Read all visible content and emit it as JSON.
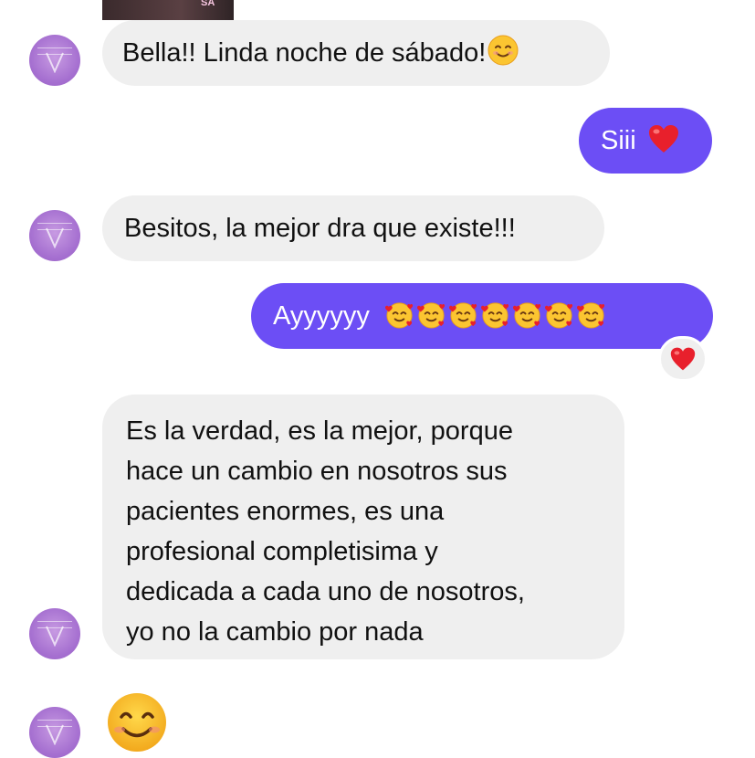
{
  "conversation": {
    "story_thumb_text": "SA",
    "messages": [
      {
        "direction": "incoming",
        "text": "Bella!! Linda noche de sábado!",
        "emoji": "smiling-face-with-smiling-eyes"
      },
      {
        "direction": "outgoing",
        "text": "Siii",
        "emoji": "red-heart"
      },
      {
        "direction": "incoming",
        "text": "Besitos, la mejor dra que existe!!!"
      },
      {
        "direction": "outgoing",
        "text": "Ayyyyyy",
        "emoji": "smiling-face-with-hearts",
        "emoji_count": 7,
        "reaction": "red-heart"
      },
      {
        "direction": "incoming",
        "lines": [
          "Es la verdad, es la mejor, porque",
          "hace un cambio en nosotros sus",
          "pacientes enormes, es una",
          "profesional completisima y",
          "dedicada a cada uno de nosotros,",
          "yo no la cambio por nada"
        ]
      },
      {
        "direction": "incoming",
        "emoji_only": "smiling-face-with-smiling-eyes"
      }
    ]
  },
  "colors": {
    "outgoing_bubble": "#6c4ef5",
    "incoming_bubble": "#efefef",
    "avatar": "#a56fd0",
    "heart": "#e8202c",
    "emoji_yellow": "#fbc531"
  }
}
